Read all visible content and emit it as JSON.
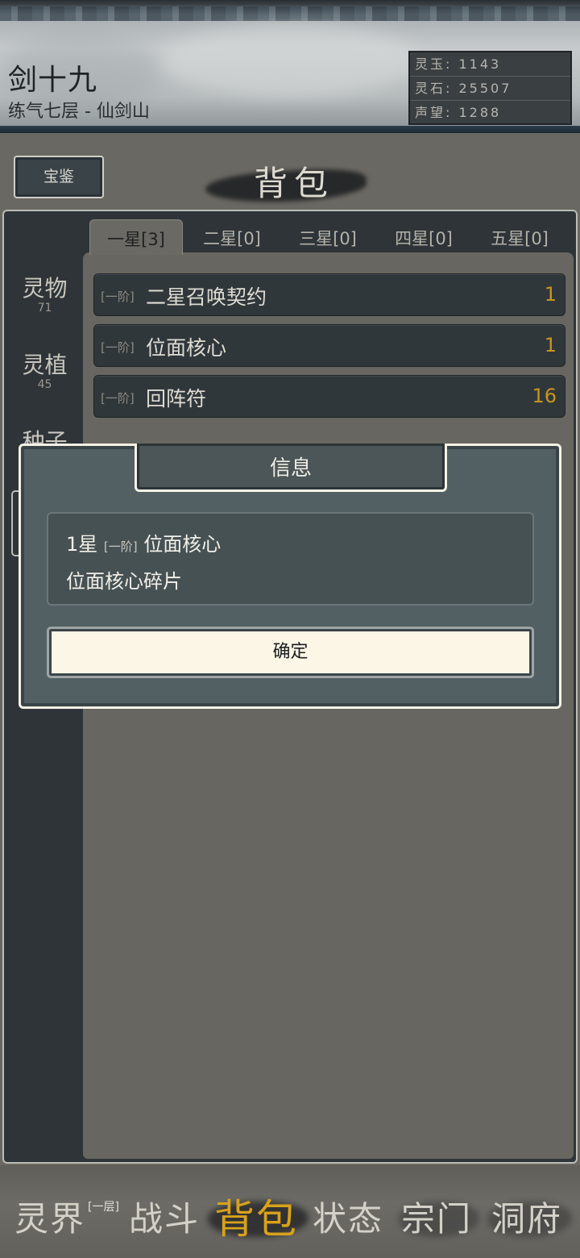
{
  "header": {
    "char_name": "剑十九",
    "char_sub": "练气七层 - 仙剑山",
    "resources": [
      {
        "label": "灵玉",
        "value": "1143"
      },
      {
        "label": "灵石",
        "value": "25507"
      },
      {
        "label": "声望",
        "value": "1288"
      }
    ]
  },
  "topbar": {
    "treasure_button": "宝鉴",
    "page_title": "背包"
  },
  "categories": [
    {
      "name": "灵物",
      "count": "71"
    },
    {
      "name": "灵植",
      "count": "45"
    },
    {
      "name": "种子",
      "count": ""
    }
  ],
  "tabs": [
    {
      "label": "一星[3]",
      "active": true
    },
    {
      "label": "二星[0]",
      "active": false
    },
    {
      "label": "三星[0]",
      "active": false
    },
    {
      "label": "四星[0]",
      "active": false
    },
    {
      "label": "五星[0]",
      "active": false
    }
  ],
  "items": [
    {
      "tier": "[一阶]",
      "name": "二星召唤契约",
      "qty": "1"
    },
    {
      "tier": "[一阶]",
      "name": "位面核心",
      "qty": "1"
    },
    {
      "tier": "[一阶]",
      "name": "回阵符",
      "qty": "16"
    }
  ],
  "modal": {
    "title": "信息",
    "line1_prefix": "1星",
    "line1_tier": "[一阶]",
    "line1_name": "位面核心",
    "line2": "位面核心碎片",
    "confirm_label": "确定"
  },
  "nav": {
    "items": [
      "灵界",
      "战斗",
      "背包",
      "状态",
      "宗门",
      "洞府"
    ],
    "active_index": 2,
    "sup_label": "[一层]"
  },
  "colors": {
    "accent_gold": "#d9a21a",
    "qty_gold": "#c7951c",
    "modal_border": "#f4f2e6"
  }
}
